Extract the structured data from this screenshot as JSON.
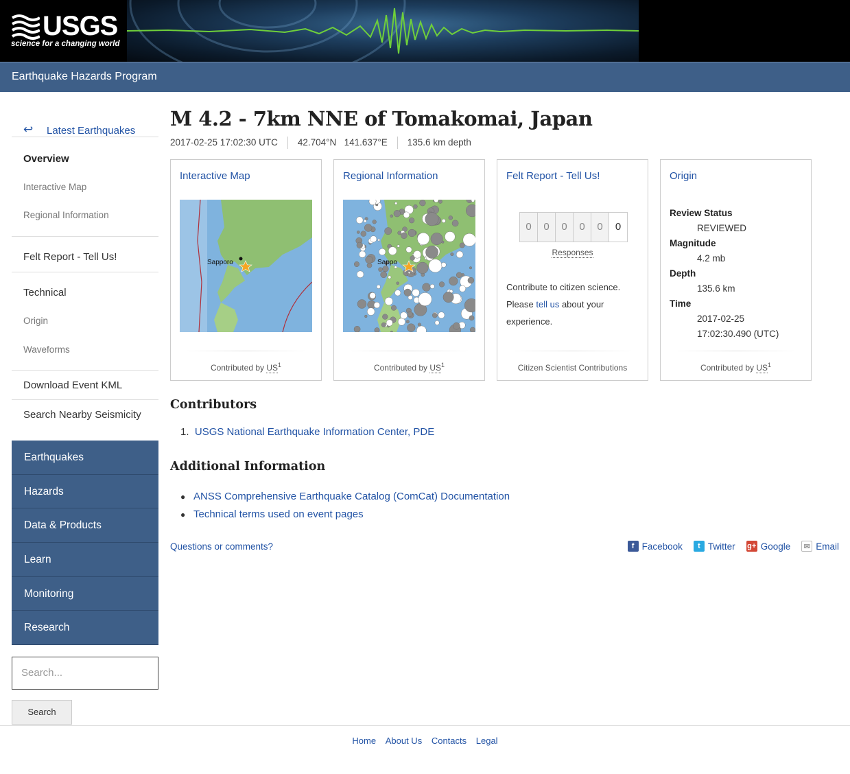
{
  "header": {
    "logo_word": "USGS",
    "logo_tagline": "science for a changing world",
    "program_title": "Earthquake Hazards Program"
  },
  "sidebar": {
    "back_label": "Latest Earthquakes",
    "overview": "Overview",
    "interactive_map": "Interactive Map",
    "regional_information": "Regional Information",
    "felt_report": "Felt Report - Tell Us!",
    "technical": "Technical",
    "origin": "Origin",
    "waveforms": "Waveforms",
    "download_kml": "Download Event KML",
    "search_nearby": "Search Nearby Seismicity",
    "nav": [
      "Earthquakes",
      "Hazards",
      "Data & Products",
      "Learn",
      "Monitoring",
      "Research"
    ],
    "search_placeholder": "Search...",
    "search_button": "Search"
  },
  "event": {
    "title": "M 4.2 - 7km NNE of Tomakomai, Japan",
    "time": "2017-02-25 17:02:30 UTC",
    "lat": "42.704°N",
    "lon": "141.637°E",
    "depth": "135.6 km depth"
  },
  "cards": {
    "map": {
      "link": "Interactive Map",
      "city_label": "Sapporo",
      "contributed_by": "Contributed by",
      "source": "US",
      "source_num": "1"
    },
    "regional": {
      "link": "Regional Information",
      "city_label": "Sappo",
      "contributed_by": "Contributed by",
      "source": "US",
      "source_num": "1"
    },
    "felt": {
      "link": "Felt Report - Tell Us!",
      "digits": [
        "0",
        "0",
        "0",
        "0",
        "0",
        "0"
      ],
      "responses_label": "Responses",
      "text_before": "Contribute to citizen science. Please ",
      "tell_us": "tell us",
      "text_after": " about your experience.",
      "footer": "Citizen Scientist Contributions"
    },
    "origin": {
      "link": "Origin",
      "review_status_label": "Review Status",
      "review_status": "REVIEWED",
      "magnitude_label": "Magnitude",
      "magnitude": "4.2 mb",
      "depth_label": "Depth",
      "depth": "135.6 km",
      "time_label": "Time",
      "time_date": "2017-02-25",
      "time_clock": "17:02:30.490 (UTC)",
      "contributed_by": "Contributed by",
      "source": "US",
      "source_num": "1"
    }
  },
  "contributors": {
    "heading": "Contributors",
    "num": "1.",
    "item": "USGS National Earthquake Information Center, PDE"
  },
  "additional": {
    "heading": "Additional Information",
    "items": [
      "ANSS Comprehensive Earthquake Catalog (ComCat) Documentation",
      "Technical terms used on event pages"
    ]
  },
  "questions": "Questions or comments?",
  "share": {
    "facebook": "Facebook",
    "twitter": "Twitter",
    "google": "Google",
    "email": "Email",
    "colors": {
      "facebook": "#3b5998",
      "twitter": "#29a9e1",
      "google": "#d34836",
      "email": "#999999"
    }
  },
  "footer": {
    "links": [
      "Home",
      "About Us",
      "Contacts",
      "Legal"
    ]
  }
}
